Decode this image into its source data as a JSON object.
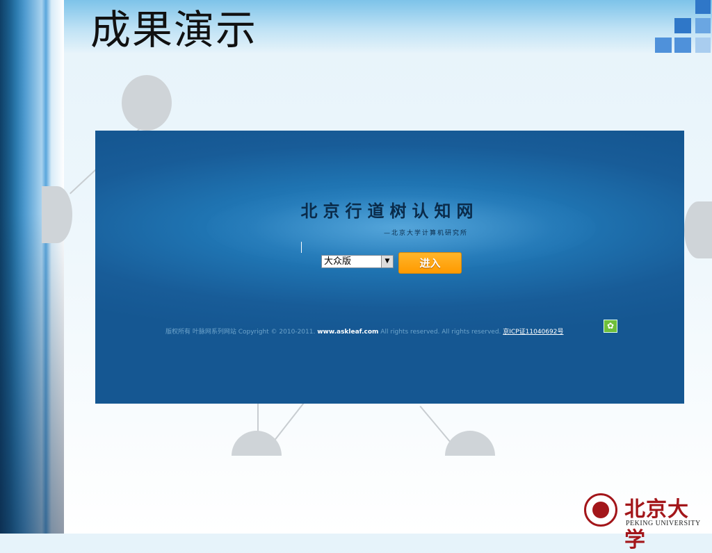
{
  "slide": {
    "title": "成果演示"
  },
  "site": {
    "logo_text": "北京行道树认知网",
    "sublogo_text": "—北京大学计算机研究所",
    "version_select": {
      "selected": "大众版"
    },
    "enter_button": "进入",
    "footer": {
      "prefix": "版权所有 叶脉网系列网站 Copyright © 2010-2011.",
      "domain": "www.askleaf.com",
      "rights": "All rights reserved. All rights reserved.",
      "icp": "京ICP证11040692号"
    }
  },
  "university": {
    "name_cn": "北京大学",
    "name_en": "PEKING UNIVERSITY"
  },
  "colors": {
    "site_bg": "#185c98",
    "button": "#ff9a00",
    "pku_red": "#a3161a"
  }
}
